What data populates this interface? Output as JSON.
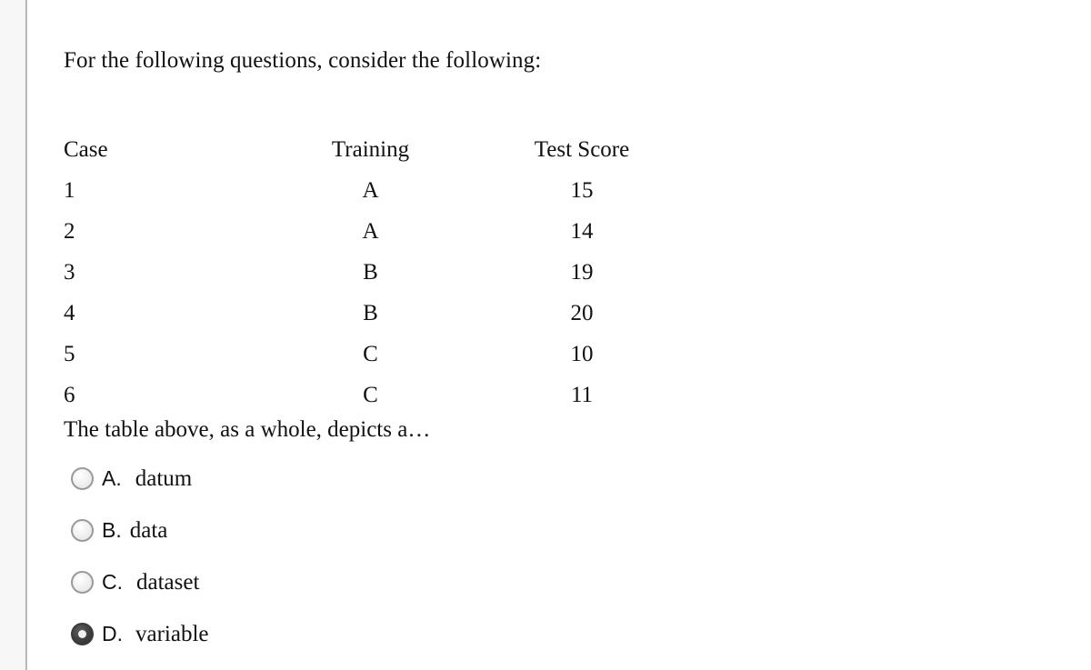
{
  "document": {
    "intro": "For the following questions, consider the following:",
    "question": "The table above, as a whole, depicts a…"
  },
  "table": {
    "headers": {
      "case": "Case",
      "training": "Training",
      "score": "Test Score"
    },
    "rows": [
      {
        "case": "1",
        "training": "A",
        "score": "15"
      },
      {
        "case": "2",
        "training": "A",
        "score": "14"
      },
      {
        "case": "3",
        "training": "B",
        "score": "19"
      },
      {
        "case": "4",
        "training": "B",
        "score": "20"
      },
      {
        "case": "5",
        "training": "C",
        "score": "10"
      },
      {
        "case": "6",
        "training": "C",
        "score": "11"
      }
    ]
  },
  "options": [
    {
      "letter": "A.",
      "text": "datum",
      "selected": false
    },
    {
      "letter": "B.",
      "text": "data",
      "selected": false
    },
    {
      "letter": "C.",
      "text": "dataset",
      "selected": false
    },
    {
      "letter": "D.",
      "text": "variable",
      "selected": true
    }
  ],
  "colors": {
    "page_background": "#ffffff",
    "gutter_background": "#f7f7f7",
    "edge_line": "#a8a8a8",
    "text": "#111111",
    "radio_unselected_border": "#9a9a9a",
    "radio_selected_fill": "#3d3d3d",
    "radio_selected_dot": "#f1f1f1"
  }
}
